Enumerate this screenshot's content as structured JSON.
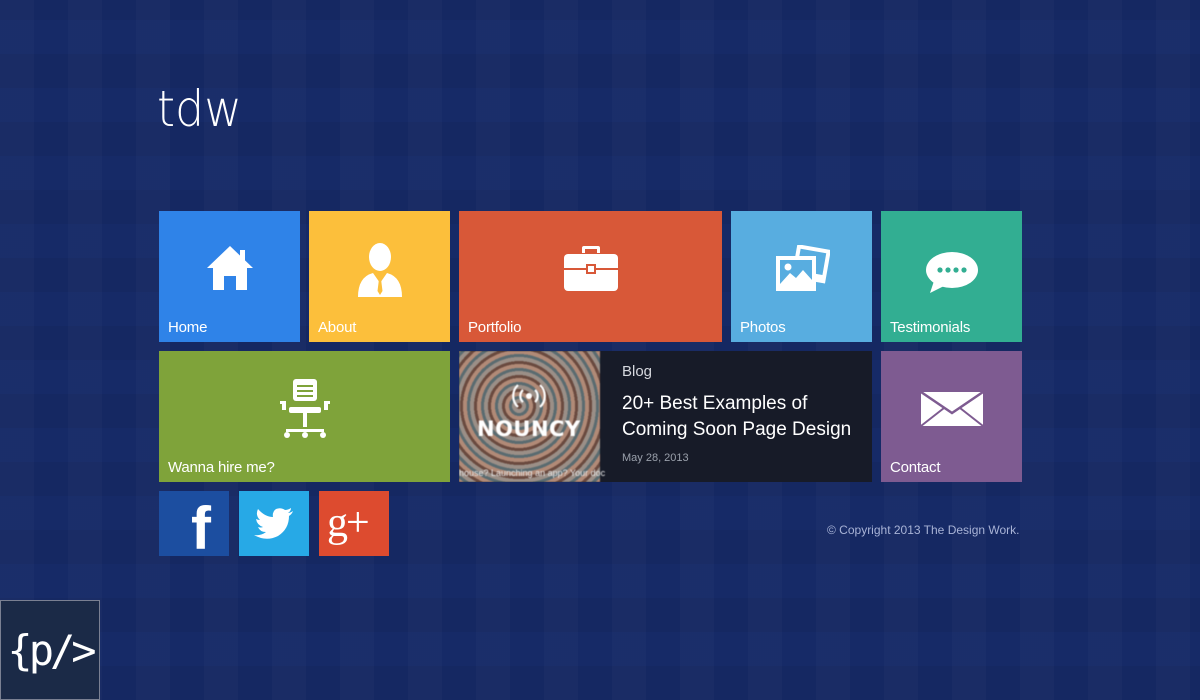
{
  "site": {
    "logo": "tdw"
  },
  "tiles": {
    "home": {
      "label": "Home",
      "color": "#2f83e8",
      "icon": "home-icon"
    },
    "about": {
      "label": "About",
      "color": "#fcbf3b",
      "icon": "user-icon"
    },
    "portfolio": {
      "label": "Portfolio",
      "color": "#d85838",
      "icon": "briefcase-icon"
    },
    "photos": {
      "label": "Photos",
      "color": "#58ade0",
      "icon": "photos-icon"
    },
    "testimonials": {
      "label": "Testimonials",
      "color": "#32ae92",
      "icon": "chat-icon"
    },
    "hire": {
      "label": "Wanna hire me?",
      "color": "#7fa33a",
      "icon": "office-chair-icon"
    },
    "contact": {
      "label": "Contact",
      "color": "#7e5b91",
      "icon": "envelope-icon"
    }
  },
  "blog": {
    "category": "Blog",
    "title": "20+ Best Examples of Coming Soon Page Design",
    "date": "May 28, 2013",
    "thumb_brand": "NOUNCY",
    "thumb_caption": "house? Launching an app? Your doc",
    "bg_color": "#171b28"
  },
  "social": {
    "facebook": {
      "color": "#1c4ea0",
      "icon": "facebook-icon",
      "glyph": "f"
    },
    "twitter": {
      "color": "#27a9e6",
      "icon": "twitter-icon"
    },
    "googleplus": {
      "color": "#dd4b2f",
      "icon": "google-plus-icon",
      "glyph": "g+"
    }
  },
  "footer": {
    "copyright": "© Copyright 2013 The Design Work."
  },
  "corner_badge": {
    "text": "{p/>"
  }
}
